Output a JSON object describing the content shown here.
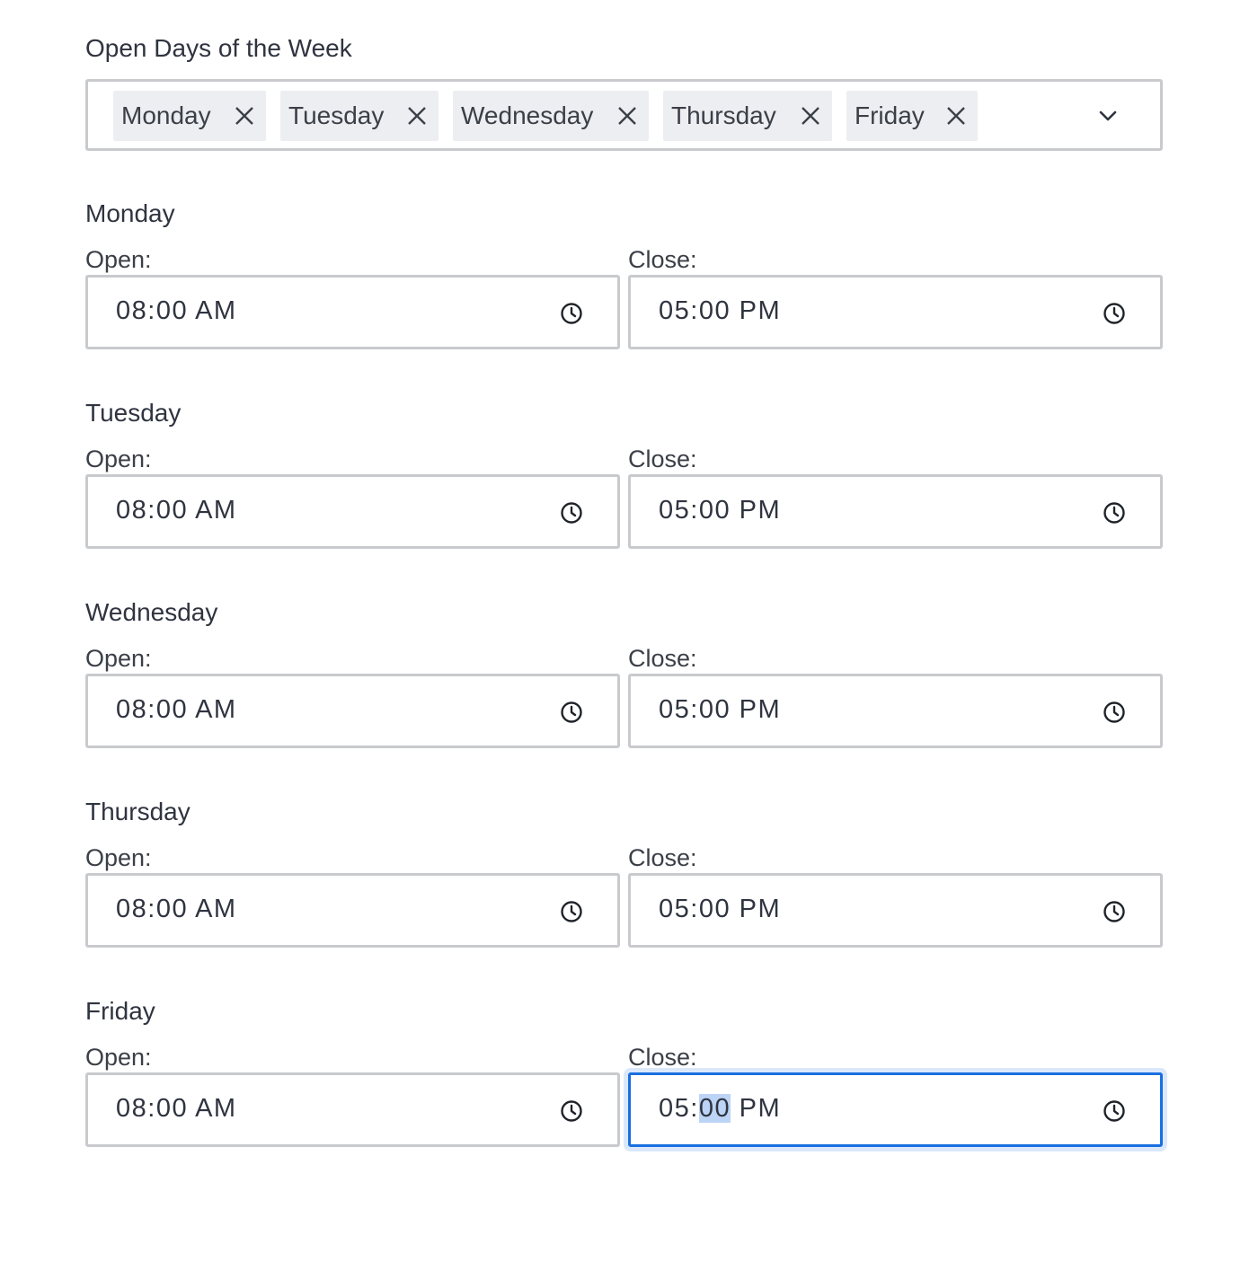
{
  "open_days": {
    "title": "Open Days of the Week",
    "chips": [
      {
        "label": "Monday"
      },
      {
        "label": "Tuesday"
      },
      {
        "label": "Wednesday"
      },
      {
        "label": "Thursday"
      },
      {
        "label": "Friday"
      }
    ],
    "chip_remove_icon": "close-icon",
    "dropdown_icon": "chevron-down-icon"
  },
  "labels": {
    "open": "Open:",
    "close": "Close:"
  },
  "days": [
    {
      "name": "Monday",
      "open": {
        "hh": "08",
        "mm": "00",
        "ampm": "AM"
      },
      "close": {
        "hh": "05",
        "mm": "00",
        "ampm": "PM"
      }
    },
    {
      "name": "Tuesday",
      "open": {
        "hh": "08",
        "mm": "00",
        "ampm": "AM"
      },
      "close": {
        "hh": "05",
        "mm": "00",
        "ampm": "PM"
      }
    },
    {
      "name": "Wednesday",
      "open": {
        "hh": "08",
        "mm": "00",
        "ampm": "AM"
      },
      "close": {
        "hh": "05",
        "mm": "00",
        "ampm": "PM"
      }
    },
    {
      "name": "Thursday",
      "open": {
        "hh": "08",
        "mm": "00",
        "ampm": "AM"
      },
      "close": {
        "hh": "05",
        "mm": "00",
        "ampm": "PM"
      }
    },
    {
      "name": "Friday",
      "open": {
        "hh": "08",
        "mm": "00",
        "ampm": "AM"
      },
      "close": {
        "hh": "05",
        "mm": "00",
        "ampm": "PM"
      }
    }
  ],
  "focus": {
    "field": "days.4.close",
    "selected_segment": "minutes"
  },
  "time_icon": "clock-icon",
  "colors": {
    "focus_border": "#1a6fe0",
    "selection": "#bcd4f5",
    "chip_bg": "#eceef1",
    "border": "#c8cacd"
  }
}
